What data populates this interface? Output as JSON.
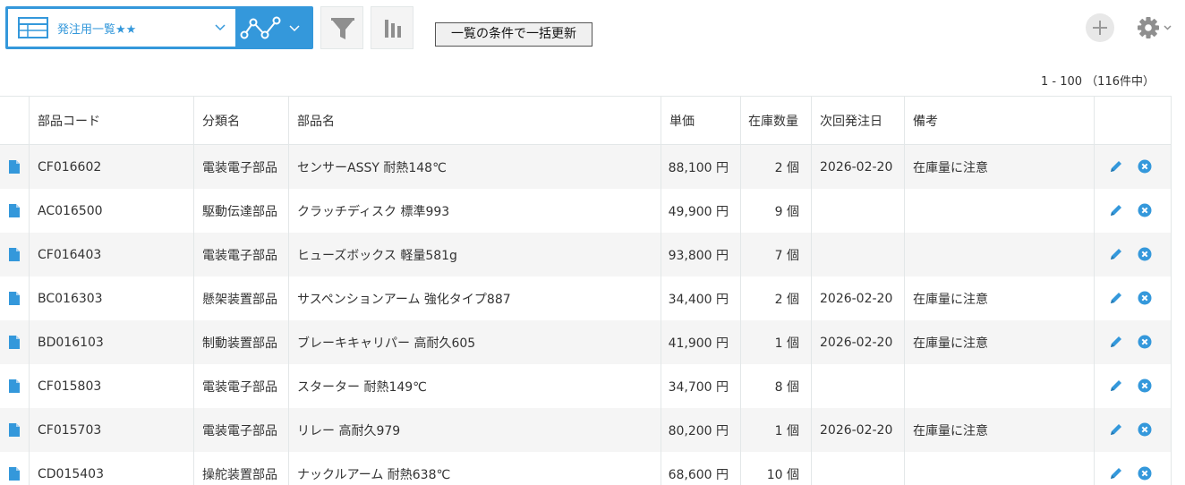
{
  "toolbar": {
    "view_name": "発注用一覧★★",
    "view_icon": "table-icon",
    "graph_icon": "line-graph-icon",
    "filter_icon": "funnel-icon",
    "chart_icon": "bar-chart-icon",
    "bulk_update_label": "一覧の条件で一括更新",
    "add_icon": "plus-icon",
    "settings_icon": "gear-icon",
    "accent_color": "#3498db"
  },
  "pager": {
    "text": "1 - 100 （116件中）"
  },
  "table": {
    "columns": [
      "部品コード",
      "分類名",
      "部品名",
      "単価",
      "在庫数量",
      "次回発注日",
      "備考"
    ],
    "rows": [
      {
        "code": "CF016602",
        "category": "電装電子部品",
        "name": "センサーASSY 耐熱148℃",
        "price": "88,100 円",
        "stock": "2 個",
        "next_order": "2026-02-20",
        "note": "在庫量に注意"
      },
      {
        "code": "AC016500",
        "category": "駆動伝達部品",
        "name": "クラッチディスク 標準993",
        "price": "49,900 円",
        "stock": "9 個",
        "next_order": "",
        "note": ""
      },
      {
        "code": "CF016403",
        "category": "電装電子部品",
        "name": "ヒューズボックス 軽量581g",
        "price": "93,800 円",
        "stock": "7 個",
        "next_order": "",
        "note": ""
      },
      {
        "code": "BC016303",
        "category": "懸架装置部品",
        "name": "サスペンションアーム 強化タイプ887",
        "price": "34,400 円",
        "stock": "2 個",
        "next_order": "2026-02-20",
        "note": "在庫量に注意"
      },
      {
        "code": "BD016103",
        "category": "制動装置部品",
        "name": "ブレーキキャリパー 高耐久605",
        "price": "41,900 円",
        "stock": "1 個",
        "next_order": "2026-02-20",
        "note": "在庫量に注意"
      },
      {
        "code": "CF015803",
        "category": "電装電子部品",
        "name": "スターター 耐熱149℃",
        "price": "34,700 円",
        "stock": "8 個",
        "next_order": "",
        "note": ""
      },
      {
        "code": "CF015703",
        "category": "電装電子部品",
        "name": "リレー 高耐久979",
        "price": "80,200 円",
        "stock": "1 個",
        "next_order": "2026-02-20",
        "note": "在庫量に注意"
      },
      {
        "code": "CD015403",
        "category": "操舵装置部品",
        "name": "ナックルアーム 耐熱638℃",
        "price": "68,600 円",
        "stock": "10 個",
        "next_order": "",
        "note": ""
      }
    ]
  }
}
